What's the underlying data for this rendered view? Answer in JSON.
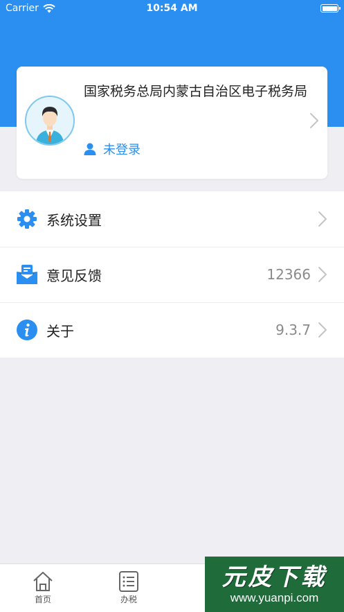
{
  "status_bar": {
    "carrier": "Carrier",
    "time": "10:54 AM"
  },
  "profile": {
    "org_name": "国家税务总局内蒙古自治区电子税务局",
    "login_status": "未登录"
  },
  "menu": [
    {
      "label": "系统设置",
      "value": "",
      "icon": "gear-icon"
    },
    {
      "label": "意见反馈",
      "value": "12366",
      "icon": "feedback-mail-icon"
    },
    {
      "label": "关于",
      "value": "9.3.7",
      "icon": "info-icon"
    }
  ],
  "tabs": [
    {
      "label": "首页",
      "icon": "home-icon"
    },
    {
      "label": "办税",
      "icon": "list-icon"
    }
  ],
  "watermark": {
    "title": "元皮下载",
    "url": "www.yuanpi.com"
  },
  "colors": {
    "primary": "#2a8ff0",
    "background": "#eeeef3"
  }
}
